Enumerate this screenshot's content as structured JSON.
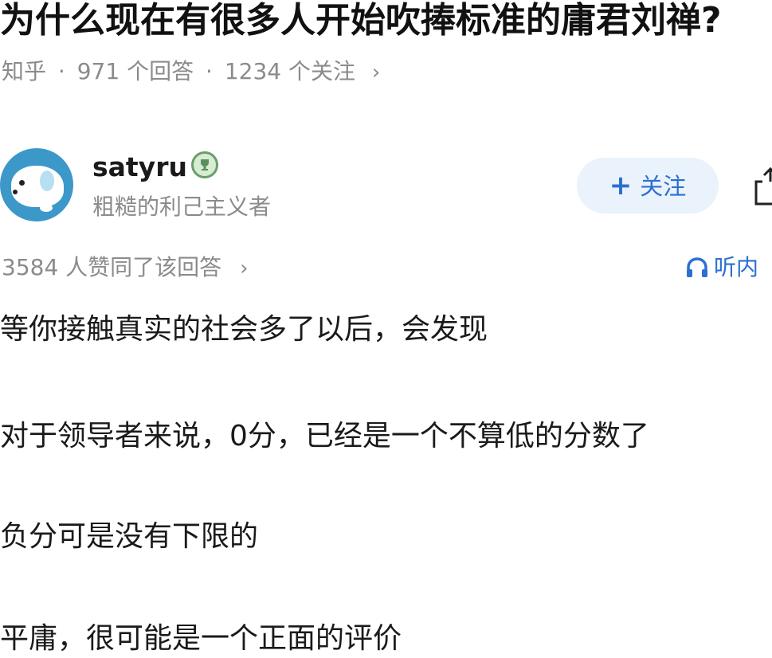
{
  "question": {
    "title": "为什么现在有很多人开始吹捧标准的庸君刘禅?",
    "source": "知乎",
    "sep": "·",
    "answers": "971 个回答",
    "followers": "1234 个关注",
    "chevron": "›"
  },
  "author": {
    "name": "satyru",
    "bio": "粗糙的利己主义者",
    "follow_plus": "+",
    "follow_label": "关注"
  },
  "answer": {
    "likes": "3584 人赞同了该回答",
    "chevron": "›",
    "listen_label": "听内",
    "paragraphs": [
      "等你接触真实的社会多了以后，会发现",
      "对于领导者来说，0分，已经是一个不算低的分数了",
      "负分可是没有下限的",
      "平庸，很可能是一个正面的评价"
    ]
  },
  "colors": {
    "accent_blue": "#2c6fd3",
    "meta_gray": "#8b8b8b",
    "follow_bg": "#eaf2fb",
    "avatar_blue": "#3c98c9"
  },
  "icons": {
    "share": "share-icon",
    "headphone": "headphone-icon",
    "badge": "trophy-badge-icon"
  }
}
